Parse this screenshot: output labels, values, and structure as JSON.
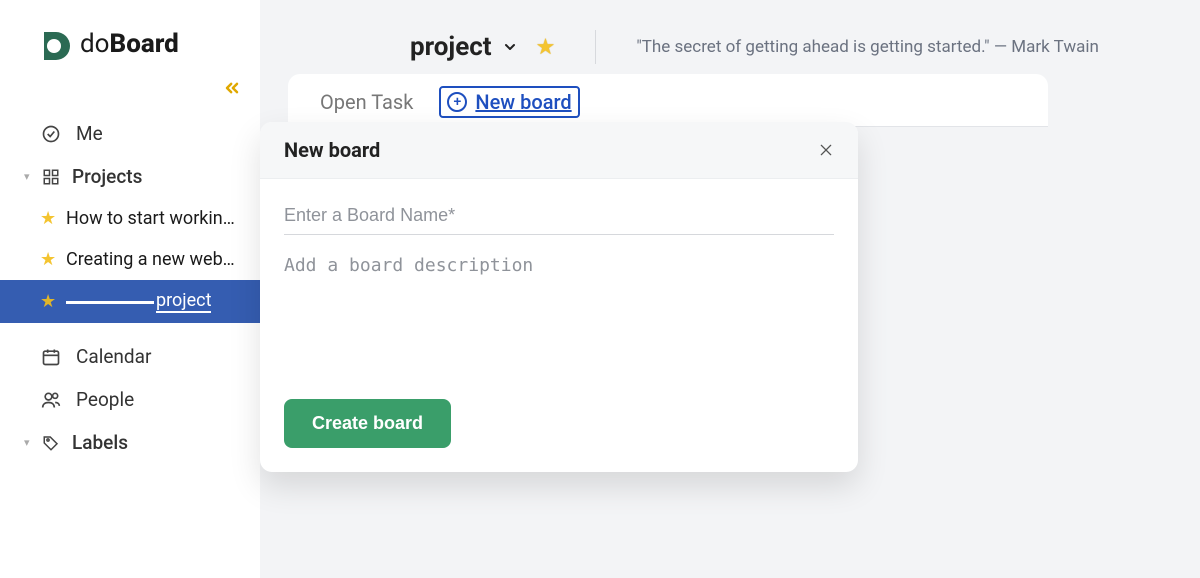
{
  "brand": {
    "prefix": "do",
    "suffix": "Board"
  },
  "sidebar": {
    "me": "Me",
    "projects_label": "Projects",
    "calendar": "Calendar",
    "people": "People",
    "labels": "Labels",
    "projects": [
      {
        "label": "How to start workin…"
      },
      {
        "label": "Creating a new web…"
      },
      {
        "label": "project"
      }
    ]
  },
  "header": {
    "project_name": "project",
    "quote_text": "\"The secret of getting ahead is getting started.\"",
    "quote_author": "— Mark Twain"
  },
  "tabs": {
    "open_task": "Open Task",
    "new_board": "New board"
  },
  "modal": {
    "title": "New board",
    "name_placeholder": "Enter a Board Name*",
    "desc_placeholder": "Add a board description",
    "create_label": "Create board"
  }
}
